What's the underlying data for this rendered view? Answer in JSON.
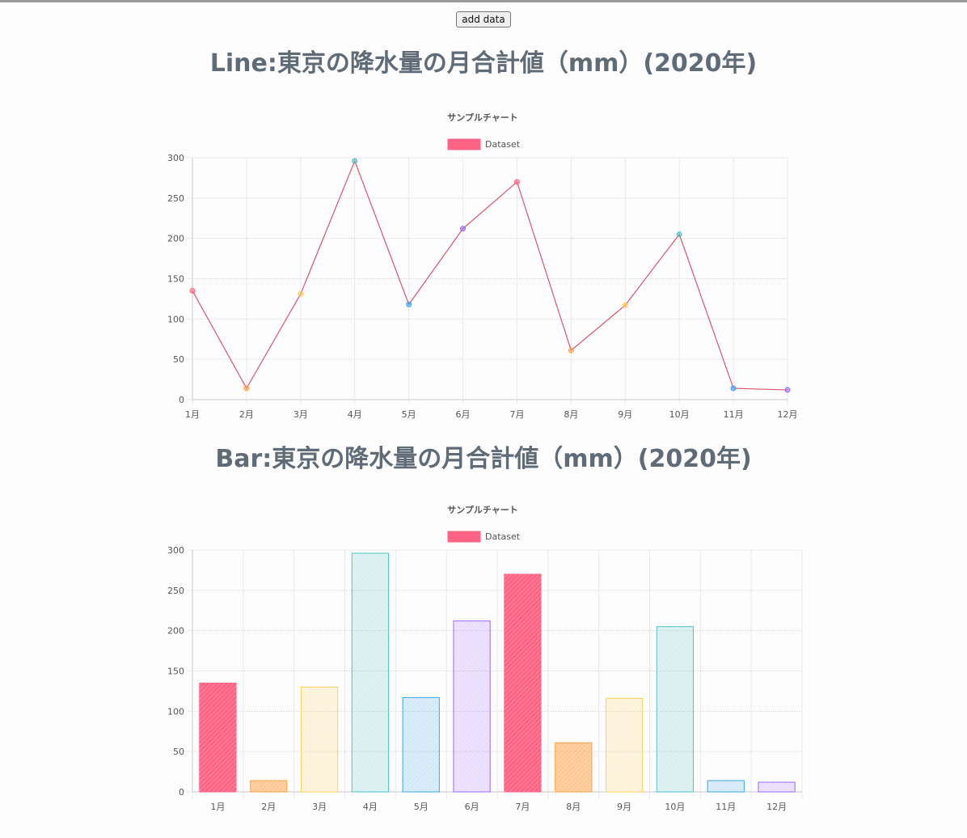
{
  "toolbar": {
    "add_label": "add data"
  },
  "headings": {
    "line": "Line:東京の降水量の月合計値（mm）(2020年)",
    "bar": "Bar:東京の降水量の月合計値（mm）(2020年)"
  },
  "colors": {
    "red": "#ff6384",
    "orange": "#ff9f40",
    "yellow": "#ffcd56",
    "teal": "#4bc0c0",
    "blue": "#36a2eb",
    "purple": "#9966ff"
  },
  "chart_data": [
    {
      "type": "line",
      "title": "サンプルチャート",
      "legend": [
        "Dataset"
      ],
      "legend_position": "top",
      "categories": [
        "1月",
        "2月",
        "3月",
        "4月",
        "5月",
        "6月",
        "7月",
        "8月",
        "9月",
        "10月",
        "11月",
        "12月"
      ],
      "series": [
        {
          "name": "Dataset",
          "values": [
            135,
            14,
            131,
            296,
            118,
            212,
            270,
            61,
            117,
            205,
            14,
            12
          ]
        }
      ],
      "ylim": [
        0,
        300
      ],
      "yticks": [
        0,
        50,
        100,
        150,
        200,
        250,
        300
      ],
      "grid": true
    },
    {
      "type": "bar",
      "title": "サンプルチャート",
      "legend": [
        "Dataset"
      ],
      "legend_position": "top",
      "categories": [
        "1月",
        "2月",
        "3月",
        "4月",
        "5月",
        "6月",
        "7月",
        "8月",
        "9月",
        "10月",
        "11月",
        "12月"
      ],
      "series": [
        {
          "name": "Dataset",
          "values": [
            135,
            14,
            130,
            296,
            117,
            212,
            270,
            61,
            116,
            205,
            14,
            12
          ]
        }
      ],
      "ylim": [
        0,
        300
      ],
      "yticks": [
        0,
        50,
        100,
        150,
        200,
        250,
        300
      ],
      "grid": true
    }
  ]
}
